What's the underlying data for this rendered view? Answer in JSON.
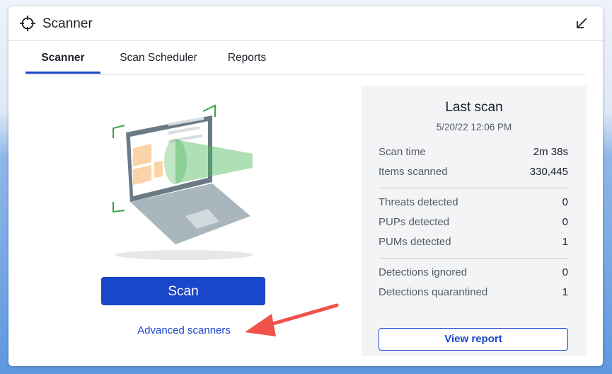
{
  "window": {
    "title": "Scanner",
    "title_icon": "crosshair-icon",
    "collapse_icon": "collapse-arrow-icon"
  },
  "tabs": [
    {
      "label": "Scanner",
      "active": true
    },
    {
      "label": "Scan Scheduler",
      "active": false
    },
    {
      "label": "Reports",
      "active": false
    }
  ],
  "main": {
    "illustration": "laptop-scan-illustration",
    "scan_button": "Scan",
    "advanced_link": "Advanced scanners",
    "annotation": "red-arrow-pointer"
  },
  "last_scan": {
    "title": "Last scan",
    "date": "5/20/22 12:06 PM",
    "rows": [
      {
        "label": "Scan time",
        "value": "2m 38s"
      },
      {
        "label": "Items scanned",
        "value": "330,445"
      },
      {
        "label": "Threats detected",
        "value": "0"
      },
      {
        "label": "PUPs detected",
        "value": "0"
      },
      {
        "label": "PUMs detected",
        "value": "1"
      },
      {
        "label": "Detections ignored",
        "value": "0"
      },
      {
        "label": "Detections quarantined",
        "value": "1"
      }
    ],
    "view_report_button": "View report"
  },
  "colors": {
    "accent": "#1a46c9",
    "annotation_red": "#f0524a",
    "scan_green": "#4bb85c"
  }
}
